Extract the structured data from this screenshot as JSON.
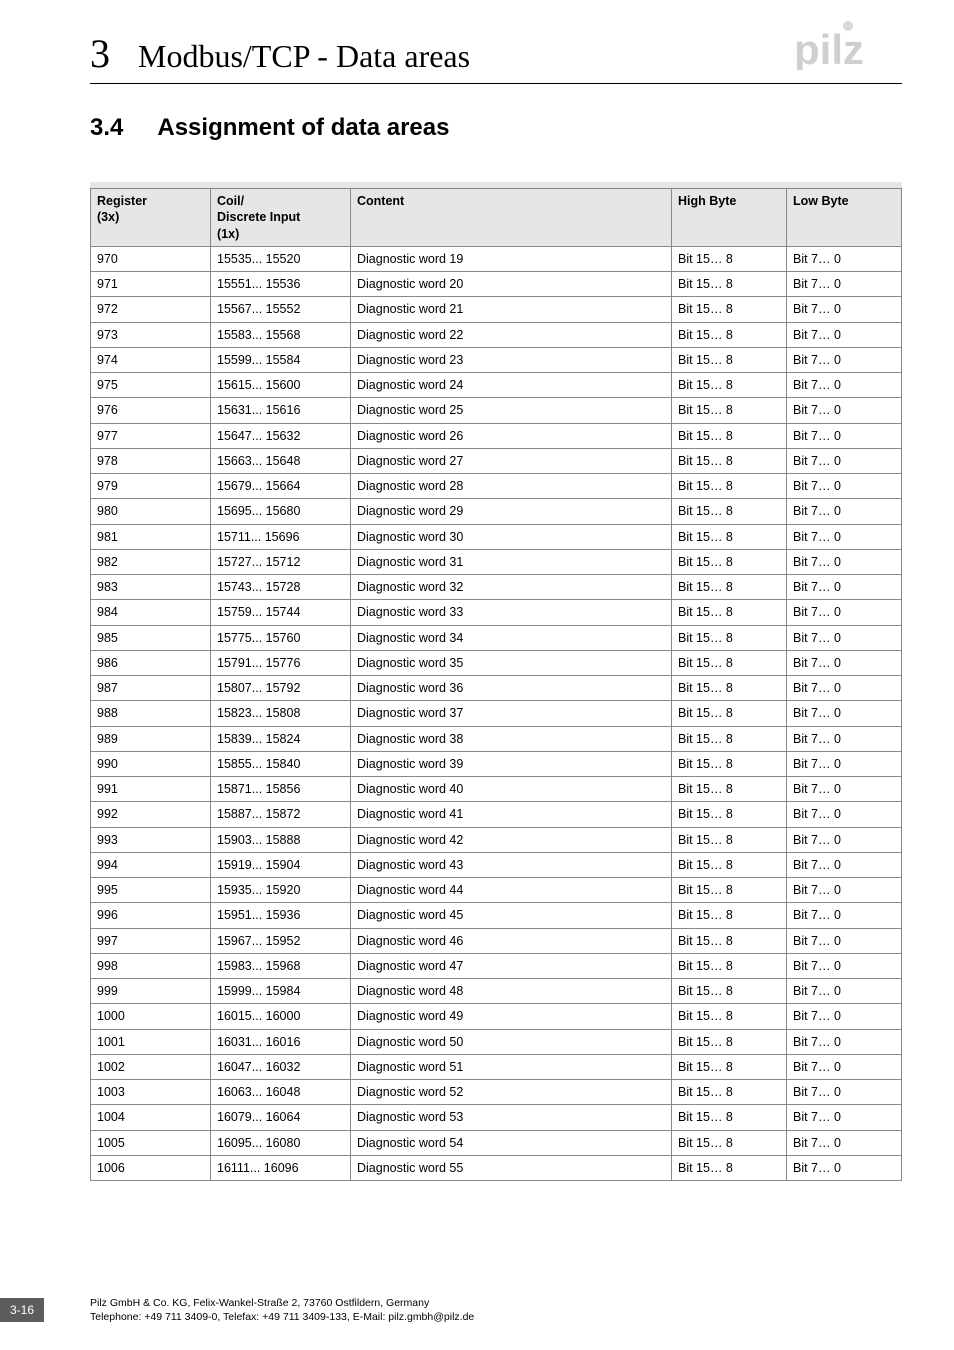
{
  "logo": {
    "brand": "pilz"
  },
  "header": {
    "chapter_number": "3",
    "chapter_title": "Modbus/TCP - Data areas"
  },
  "section": {
    "number": "3.4",
    "title": "Assignment of data areas"
  },
  "table": {
    "headers": {
      "register": "Register\n(3x)",
      "coil": "Coil/\nDiscrete Input\n(1x)",
      "content": "Content",
      "high": "High Byte",
      "low": "Low Byte"
    },
    "rows": [
      {
        "reg": "970",
        "coil": "15535... 15520",
        "content": "Diagnostic word 19",
        "high": "Bit 15… 8",
        "low": "Bit 7… 0"
      },
      {
        "reg": "971",
        "coil": "15551... 15536",
        "content": "Diagnostic word 20",
        "high": "Bit 15… 8",
        "low": "Bit 7… 0"
      },
      {
        "reg": "972",
        "coil": "15567... 15552",
        "content": "Diagnostic word 21",
        "high": "Bit 15… 8",
        "low": "Bit 7… 0"
      },
      {
        "reg": "973",
        "coil": "15583... 15568",
        "content": "Diagnostic word 22",
        "high": "Bit 15… 8",
        "low": "Bit 7… 0"
      },
      {
        "reg": "974",
        "coil": "15599... 15584",
        "content": "Diagnostic word 23",
        "high": "Bit 15… 8",
        "low": "Bit 7… 0"
      },
      {
        "reg": "975",
        "coil": "15615... 15600",
        "content": "Diagnostic word 24",
        "high": "Bit 15… 8",
        "low": "Bit 7… 0"
      },
      {
        "reg": "976",
        "coil": "15631... 15616",
        "content": "Diagnostic word 25",
        "high": "Bit 15… 8",
        "low": "Bit 7… 0"
      },
      {
        "reg": "977",
        "coil": "15647... 15632",
        "content": "Diagnostic word 26",
        "high": "Bit 15… 8",
        "low": "Bit 7… 0"
      },
      {
        "reg": "978",
        "coil": "15663... 15648",
        "content": "Diagnostic word 27",
        "high": "Bit 15… 8",
        "low": "Bit 7… 0"
      },
      {
        "reg": "979",
        "coil": "15679... 15664",
        "content": "Diagnostic word 28",
        "high": "Bit 15… 8",
        "low": "Bit 7… 0"
      },
      {
        "reg": "980",
        "coil": "15695... 15680",
        "content": "Diagnostic word 29",
        "high": "Bit 15… 8",
        "low": "Bit 7… 0"
      },
      {
        "reg": "981",
        "coil": "15711... 15696",
        "content": "Diagnostic word 30",
        "high": "Bit 15… 8",
        "low": "Bit 7… 0"
      },
      {
        "reg": "982",
        "coil": "15727... 15712",
        "content": "Diagnostic word 31",
        "high": "Bit 15… 8",
        "low": "Bit 7… 0"
      },
      {
        "reg": "983",
        "coil": "15743... 15728",
        "content": "Diagnostic word 32",
        "high": "Bit 15… 8",
        "low": "Bit 7… 0"
      },
      {
        "reg": "984",
        "coil": "15759... 15744",
        "content": "Diagnostic word 33",
        "high": "Bit 15… 8",
        "low": "Bit 7… 0"
      },
      {
        "reg": "985",
        "coil": "15775... 15760",
        "content": "Diagnostic word 34",
        "high": "Bit 15… 8",
        "low": "Bit 7… 0"
      },
      {
        "reg": "986",
        "coil": "15791... 15776",
        "content": "Diagnostic word 35",
        "high": "Bit 15… 8",
        "low": "Bit 7… 0"
      },
      {
        "reg": "987",
        "coil": "15807... 15792",
        "content": "Diagnostic word 36",
        "high": "Bit 15… 8",
        "low": "Bit 7… 0"
      },
      {
        "reg": "988",
        "coil": "15823... 15808",
        "content": "Diagnostic word 37",
        "high": "Bit 15… 8",
        "low": "Bit 7… 0"
      },
      {
        "reg": "989",
        "coil": "15839... 15824",
        "content": "Diagnostic word 38",
        "high": "Bit 15… 8",
        "low": "Bit 7… 0"
      },
      {
        "reg": "990",
        "coil": "15855... 15840",
        "content": "Diagnostic word 39",
        "high": "Bit 15… 8",
        "low": "Bit 7… 0"
      },
      {
        "reg": "991",
        "coil": "15871... 15856",
        "content": "Diagnostic word 40",
        "high": "Bit 15… 8",
        "low": "Bit 7… 0"
      },
      {
        "reg": "992",
        "coil": "15887... 15872",
        "content": "Diagnostic word 41",
        "high": "Bit 15… 8",
        "low": "Bit 7… 0"
      },
      {
        "reg": "993",
        "coil": "15903... 15888",
        "content": "Diagnostic word 42",
        "high": "Bit 15… 8",
        "low": "Bit 7… 0"
      },
      {
        "reg": "994",
        "coil": "15919... 15904",
        "content": "Diagnostic word 43",
        "high": "Bit 15… 8",
        "low": "Bit 7… 0"
      },
      {
        "reg": "995",
        "coil": "15935... 15920",
        "content": "Diagnostic word 44",
        "high": "Bit 15… 8",
        "low": "Bit 7… 0"
      },
      {
        "reg": "996",
        "coil": "15951... 15936",
        "content": "Diagnostic word 45",
        "high": "Bit 15… 8",
        "low": "Bit 7… 0"
      },
      {
        "reg": "997",
        "coil": "15967... 15952",
        "content": "Diagnostic word 46",
        "high": "Bit 15… 8",
        "low": "Bit 7… 0"
      },
      {
        "reg": "998",
        "coil": "15983... 15968",
        "content": "Diagnostic word 47",
        "high": "Bit 15… 8",
        "low": "Bit 7… 0"
      },
      {
        "reg": "999",
        "coil": "15999... 15984",
        "content": "Diagnostic word 48",
        "high": "Bit 15… 8",
        "low": "Bit 7… 0"
      },
      {
        "reg": "1000",
        "coil": "16015... 16000",
        "content": "Diagnostic word 49",
        "high": "Bit 15… 8",
        "low": "Bit 7… 0"
      },
      {
        "reg": "1001",
        "coil": "16031... 16016",
        "content": "Diagnostic word 50",
        "high": "Bit 15… 8",
        "low": "Bit 7… 0"
      },
      {
        "reg": "1002",
        "coil": "16047... 16032",
        "content": "Diagnostic word 51",
        "high": "Bit 15… 8",
        "low": "Bit 7… 0"
      },
      {
        "reg": "1003",
        "coil": "16063... 16048",
        "content": "Diagnostic word 52",
        "high": "Bit 15… 8",
        "low": "Bit 7… 0"
      },
      {
        "reg": "1004",
        "coil": "16079... 16064",
        "content": "Diagnostic word 53",
        "high": "Bit 15… 8",
        "low": "Bit 7… 0"
      },
      {
        "reg": "1005",
        "coil": "16095... 16080",
        "content": "Diagnostic word 54",
        "high": "Bit 15… 8",
        "low": "Bit 7… 0"
      },
      {
        "reg": "1006",
        "coil": "16111... 16096",
        "content": "Diagnostic word 55",
        "high": "Bit 15… 8",
        "low": "Bit 7… 0"
      }
    ]
  },
  "page_number": "3-16",
  "footer": {
    "line1": "Pilz GmbH & Co. KG, Felix-Wankel-Straße 2, 73760 Ostfildern, Germany",
    "line2": "Telephone: +49 711 3409-0, Telefax: +49 711 3409-133, E-Mail: pilz.gmbh@pilz.de"
  }
}
